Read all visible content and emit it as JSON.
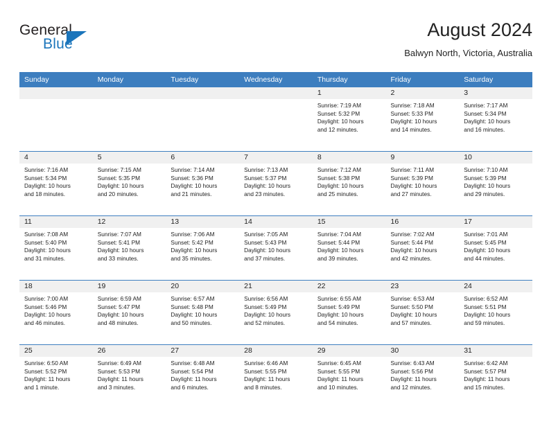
{
  "brand": {
    "line1": "General",
    "line2": "Blue",
    "triangle_color": "#1b75bb"
  },
  "header": {
    "title": "August 2024",
    "subtitle": "Balwyn North, Victoria, Australia"
  },
  "theme": {
    "header_blue": "#3d7ebf",
    "daynum_band": "#f0f0f0",
    "text": "#222222"
  },
  "weekday_headers": [
    "Sunday",
    "Monday",
    "Tuesday",
    "Wednesday",
    "Thursday",
    "Friday",
    "Saturday"
  ],
  "weeks": [
    [
      {
        "day": "",
        "sunrise": "",
        "sunset": "",
        "daylight1": "",
        "daylight2": ""
      },
      {
        "day": "",
        "sunrise": "",
        "sunset": "",
        "daylight1": "",
        "daylight2": ""
      },
      {
        "day": "",
        "sunrise": "",
        "sunset": "",
        "daylight1": "",
        "daylight2": ""
      },
      {
        "day": "",
        "sunrise": "",
        "sunset": "",
        "daylight1": "",
        "daylight2": ""
      },
      {
        "day": "1",
        "sunrise": "Sunrise: 7:19 AM",
        "sunset": "Sunset: 5:32 PM",
        "daylight1": "Daylight: 10 hours",
        "daylight2": "and 12 minutes."
      },
      {
        "day": "2",
        "sunrise": "Sunrise: 7:18 AM",
        "sunset": "Sunset: 5:33 PM",
        "daylight1": "Daylight: 10 hours",
        "daylight2": "and 14 minutes."
      },
      {
        "day": "3",
        "sunrise": "Sunrise: 7:17 AM",
        "sunset": "Sunset: 5:34 PM",
        "daylight1": "Daylight: 10 hours",
        "daylight2": "and 16 minutes."
      }
    ],
    [
      {
        "day": "4",
        "sunrise": "Sunrise: 7:16 AM",
        "sunset": "Sunset: 5:34 PM",
        "daylight1": "Daylight: 10 hours",
        "daylight2": "and 18 minutes."
      },
      {
        "day": "5",
        "sunrise": "Sunrise: 7:15 AM",
        "sunset": "Sunset: 5:35 PM",
        "daylight1": "Daylight: 10 hours",
        "daylight2": "and 20 minutes."
      },
      {
        "day": "6",
        "sunrise": "Sunrise: 7:14 AM",
        "sunset": "Sunset: 5:36 PM",
        "daylight1": "Daylight: 10 hours",
        "daylight2": "and 21 minutes."
      },
      {
        "day": "7",
        "sunrise": "Sunrise: 7:13 AM",
        "sunset": "Sunset: 5:37 PM",
        "daylight1": "Daylight: 10 hours",
        "daylight2": "and 23 minutes."
      },
      {
        "day": "8",
        "sunrise": "Sunrise: 7:12 AM",
        "sunset": "Sunset: 5:38 PM",
        "daylight1": "Daylight: 10 hours",
        "daylight2": "and 25 minutes."
      },
      {
        "day": "9",
        "sunrise": "Sunrise: 7:11 AM",
        "sunset": "Sunset: 5:39 PM",
        "daylight1": "Daylight: 10 hours",
        "daylight2": "and 27 minutes."
      },
      {
        "day": "10",
        "sunrise": "Sunrise: 7:10 AM",
        "sunset": "Sunset: 5:39 PM",
        "daylight1": "Daylight: 10 hours",
        "daylight2": "and 29 minutes."
      }
    ],
    [
      {
        "day": "11",
        "sunrise": "Sunrise: 7:08 AM",
        "sunset": "Sunset: 5:40 PM",
        "daylight1": "Daylight: 10 hours",
        "daylight2": "and 31 minutes."
      },
      {
        "day": "12",
        "sunrise": "Sunrise: 7:07 AM",
        "sunset": "Sunset: 5:41 PM",
        "daylight1": "Daylight: 10 hours",
        "daylight2": "and 33 minutes."
      },
      {
        "day": "13",
        "sunrise": "Sunrise: 7:06 AM",
        "sunset": "Sunset: 5:42 PM",
        "daylight1": "Daylight: 10 hours",
        "daylight2": "and 35 minutes."
      },
      {
        "day": "14",
        "sunrise": "Sunrise: 7:05 AM",
        "sunset": "Sunset: 5:43 PM",
        "daylight1": "Daylight: 10 hours",
        "daylight2": "and 37 minutes."
      },
      {
        "day": "15",
        "sunrise": "Sunrise: 7:04 AM",
        "sunset": "Sunset: 5:44 PM",
        "daylight1": "Daylight: 10 hours",
        "daylight2": "and 39 minutes."
      },
      {
        "day": "16",
        "sunrise": "Sunrise: 7:02 AM",
        "sunset": "Sunset: 5:44 PM",
        "daylight1": "Daylight: 10 hours",
        "daylight2": "and 42 minutes."
      },
      {
        "day": "17",
        "sunrise": "Sunrise: 7:01 AM",
        "sunset": "Sunset: 5:45 PM",
        "daylight1": "Daylight: 10 hours",
        "daylight2": "and 44 minutes."
      }
    ],
    [
      {
        "day": "18",
        "sunrise": "Sunrise: 7:00 AM",
        "sunset": "Sunset: 5:46 PM",
        "daylight1": "Daylight: 10 hours",
        "daylight2": "and 46 minutes."
      },
      {
        "day": "19",
        "sunrise": "Sunrise: 6:59 AM",
        "sunset": "Sunset: 5:47 PM",
        "daylight1": "Daylight: 10 hours",
        "daylight2": "and 48 minutes."
      },
      {
        "day": "20",
        "sunrise": "Sunrise: 6:57 AM",
        "sunset": "Sunset: 5:48 PM",
        "daylight1": "Daylight: 10 hours",
        "daylight2": "and 50 minutes."
      },
      {
        "day": "21",
        "sunrise": "Sunrise: 6:56 AM",
        "sunset": "Sunset: 5:49 PM",
        "daylight1": "Daylight: 10 hours",
        "daylight2": "and 52 minutes."
      },
      {
        "day": "22",
        "sunrise": "Sunrise: 6:55 AM",
        "sunset": "Sunset: 5:49 PM",
        "daylight1": "Daylight: 10 hours",
        "daylight2": "and 54 minutes."
      },
      {
        "day": "23",
        "sunrise": "Sunrise: 6:53 AM",
        "sunset": "Sunset: 5:50 PM",
        "daylight1": "Daylight: 10 hours",
        "daylight2": "and 57 minutes."
      },
      {
        "day": "24",
        "sunrise": "Sunrise: 6:52 AM",
        "sunset": "Sunset: 5:51 PM",
        "daylight1": "Daylight: 10 hours",
        "daylight2": "and 59 minutes."
      }
    ],
    [
      {
        "day": "25",
        "sunrise": "Sunrise: 6:50 AM",
        "sunset": "Sunset: 5:52 PM",
        "daylight1": "Daylight: 11 hours",
        "daylight2": "and 1 minute."
      },
      {
        "day": "26",
        "sunrise": "Sunrise: 6:49 AM",
        "sunset": "Sunset: 5:53 PM",
        "daylight1": "Daylight: 11 hours",
        "daylight2": "and 3 minutes."
      },
      {
        "day": "27",
        "sunrise": "Sunrise: 6:48 AM",
        "sunset": "Sunset: 5:54 PM",
        "daylight1": "Daylight: 11 hours",
        "daylight2": "and 6 minutes."
      },
      {
        "day": "28",
        "sunrise": "Sunrise: 6:46 AM",
        "sunset": "Sunset: 5:55 PM",
        "daylight1": "Daylight: 11 hours",
        "daylight2": "and 8 minutes."
      },
      {
        "day": "29",
        "sunrise": "Sunrise: 6:45 AM",
        "sunset": "Sunset: 5:55 PM",
        "daylight1": "Daylight: 11 hours",
        "daylight2": "and 10 minutes."
      },
      {
        "day": "30",
        "sunrise": "Sunrise: 6:43 AM",
        "sunset": "Sunset: 5:56 PM",
        "daylight1": "Daylight: 11 hours",
        "daylight2": "and 12 minutes."
      },
      {
        "day": "31",
        "sunrise": "Sunrise: 6:42 AM",
        "sunset": "Sunset: 5:57 PM",
        "daylight1": "Daylight: 11 hours",
        "daylight2": "and 15 minutes."
      }
    ]
  ]
}
